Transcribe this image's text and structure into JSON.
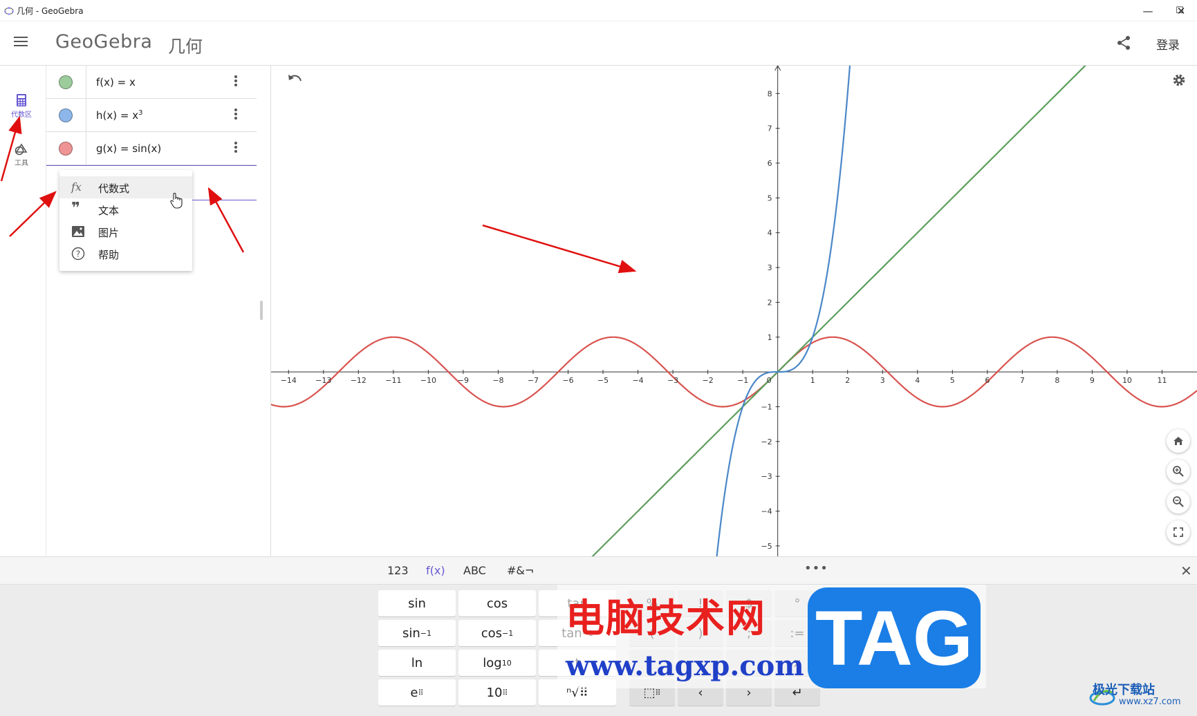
{
  "window": {
    "title": "几何 - GeoGebra",
    "minimize": "—",
    "maximize": "☐",
    "close": "✕"
  },
  "header": {
    "logo": "GeoGebra",
    "app_name": "几何",
    "login": "登录"
  },
  "rail": {
    "items": [
      {
        "label": "代数区",
        "icon": "calculator-icon",
        "active": true
      },
      {
        "label": "工具",
        "icon": "tools-icon",
        "active": false
      }
    ]
  },
  "algebra": {
    "rows": [
      {
        "expr": "f(x)  =  x",
        "color": "#8fbf8f"
      },
      {
        "expr_base": "h(x)  =  x",
        "sup": "3",
        "color": "#7aa7e0"
      },
      {
        "expr": "g(x)  =  sin(x)",
        "color": "#e88080"
      }
    ]
  },
  "context_menu": {
    "items": [
      {
        "label": "代数式",
        "icon": "fx-icon"
      },
      {
        "label": "文本",
        "icon": "quote-icon"
      },
      {
        "label": "图片",
        "icon": "image-icon"
      },
      {
        "label": "帮助",
        "icon": "help-icon"
      }
    ]
  },
  "graph": {
    "x_ticks": [
      "−14",
      "−13",
      "−12",
      "−11",
      "−10",
      "−9",
      "−8",
      "−7",
      "−6",
      "−5",
      "−4",
      "−3",
      "−2",
      "−1",
      "0",
      "1",
      "2",
      "3",
      "4",
      "5",
      "6",
      "7",
      "8",
      "9",
      "10",
      "11"
    ],
    "y_ticks": [
      "8",
      "7",
      "6",
      "5",
      "4",
      "3",
      "2",
      "1",
      "−1",
      "−2",
      "−3",
      "−4",
      "−5"
    ],
    "colors": {
      "f": "#5c9e5c",
      "h": "#4a87c8",
      "g": "#d9534f"
    },
    "functions": [
      "f(x) = x",
      "h(x) = x^3",
      "g(x) = sin(x)"
    ],
    "x_range": [
      -14.5,
      12
    ],
    "y_range": [
      -5.3,
      8.8
    ]
  },
  "keyboard": {
    "tabs": [
      "123",
      "f(x)",
      "ABC",
      "#&¬"
    ],
    "active_tab": "f(x)",
    "more": "•••",
    "close": "✕",
    "row1": [
      "sin",
      "cos",
      "tan",
      "%",
      "!",
      "$",
      "°"
    ],
    "row2_base": [
      "sin",
      "cos",
      "tan"
    ],
    "row2_sup": "−1",
    "row2_rest": [
      "(",
      ")",
      ";",
      ":="
    ],
    "row3": {
      "ln": "ln",
      "log": "log",
      "log_sub": "10",
      "t": "t",
      "x_sym": "x"
    },
    "row4": {
      "e": "e",
      "ten": "10",
      "root": "ⁿ√",
      "left": "‹",
      "right": "›",
      "enter": "↵"
    }
  },
  "watermark": {
    "line1": "电脑技术网",
    "line2": "www.tagxp.com",
    "tag": "TAG",
    "brand": "极光下载站",
    "brand_url": "www.xz7.com"
  }
}
